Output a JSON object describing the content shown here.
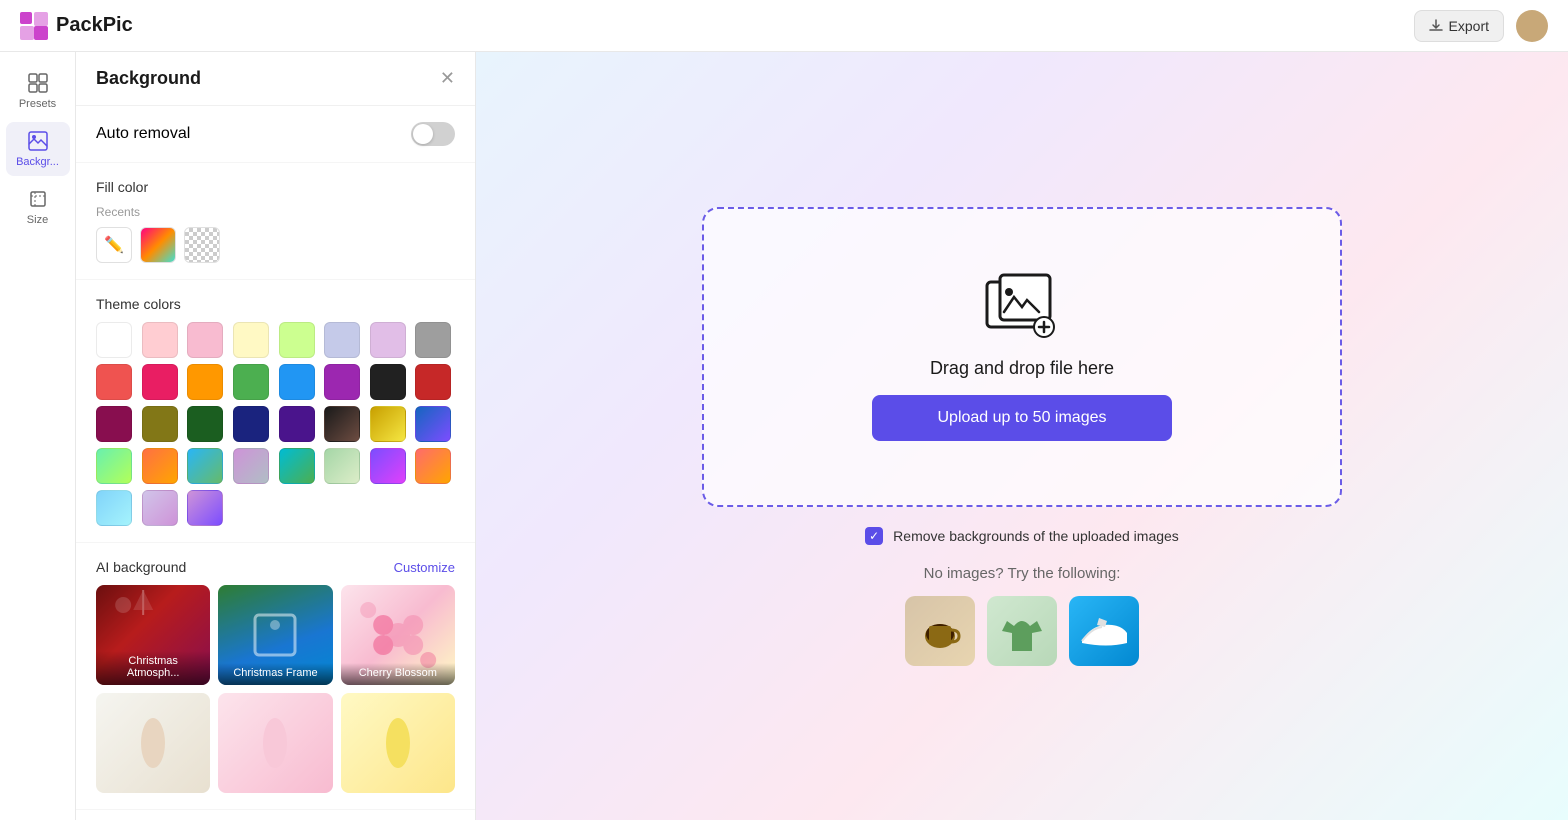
{
  "app": {
    "name": "PackPic"
  },
  "header": {
    "export_label": "Export",
    "export_icon": "download-icon"
  },
  "sidebar": {
    "items": [
      {
        "id": "presets",
        "label": "Presets",
        "icon": "grid-icon",
        "active": false
      },
      {
        "id": "background",
        "label": "Backgr...",
        "icon": "background-icon",
        "active": true
      },
      {
        "id": "size",
        "label": "Size",
        "icon": "size-icon",
        "active": false
      }
    ]
  },
  "panel": {
    "title": "Background",
    "auto_removal_label": "Auto removal",
    "auto_removal_on": false,
    "fill_color_label": "Fill color",
    "recents_label": "Recents",
    "theme_colors_label": "Theme colors",
    "ai_background_label": "AI background",
    "customize_label": "Customize",
    "theme_colors": [
      "#ffffff",
      "#ffcdd2",
      "#f8bbd0",
      "#fff9c4",
      "#ccff90",
      "#c5cae9",
      "#e1bee7",
      "#9e9e9e",
      "#ef5350",
      "#e91e63",
      "#ff9800",
      "#4caf50",
      "#2196f3",
      "#9c27b0",
      "#212121",
      "#c62828",
      "#880e4f",
      "#827717",
      "#1b5e20",
      "#1a237e",
      "#4a148c",
      "#1a1a1a",
      "#8d6e63",
      "#1565c0",
      "#69f0ae",
      "#ff7043",
      "#29b6f6",
      "#ce93d8"
    ],
    "gradient_swatches": [
      {
        "from": "#00bcd4",
        "to": "#4caf50"
      },
      {
        "from": "#69f0ae",
        "to": "#b2ff59"
      },
      {
        "from": "#7c4dff",
        "to": "#e040fb"
      },
      {
        "from": "#ff6b6b",
        "to": "#ffa500"
      },
      {
        "from": "#29b6f6",
        "to": "#66bb6a"
      },
      {
        "from": "#ce93d8",
        "to": "#b0bec5"
      }
    ],
    "ai_items": [
      {
        "id": "christmas-atmo",
        "label": "Christmas Atmosph..."
      },
      {
        "id": "christmas-frame",
        "label": "Christmas Frame"
      },
      {
        "id": "cherry-blossom",
        "label": "Cherry Blossom"
      }
    ]
  },
  "canvas": {
    "drop_text": "Drag and drop file here",
    "upload_label": "Upload up to 50 images",
    "checkbox_label": "Remove backgrounds of the uploaded images",
    "no_images_text": "No images? Try the following:"
  }
}
